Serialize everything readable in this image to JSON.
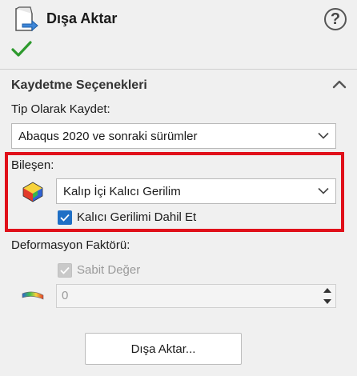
{
  "header": {
    "title": "Dışa Aktar",
    "help_label": "?",
    "icon": "export-document-icon",
    "confirm_icon": "checkmark-icon"
  },
  "save_options": {
    "section_title": "Kaydetme Seçenekleri",
    "collapse_icon": "chevron-up-icon",
    "save_as_label": "Tip Olarak Kaydet:",
    "save_as_value": "Abaqus 2020 ve sonraki sürümler"
  },
  "component": {
    "label": "Bileşen:",
    "icon": "stress-part-icon",
    "value": "Kalıp İçi Kalıcı Gerilim",
    "include_residual_label": "Kalıcı Gerilimi Dahil Et",
    "include_residual_checked": true,
    "highlight_color": "#e0101a"
  },
  "deformation": {
    "label": "Deformasyon Faktörü:",
    "fixed_value_label": "Sabit Değer",
    "fixed_value_checked": true,
    "fixed_value_enabled": false,
    "icon": "deformation-scale-icon",
    "value": "0"
  },
  "actions": {
    "export_button_label": "Dışa Aktar..."
  },
  "colors": {
    "accent": "#1f6fc5",
    "confirm_green": "#2e9a2e",
    "background": "#f0f0f0"
  }
}
